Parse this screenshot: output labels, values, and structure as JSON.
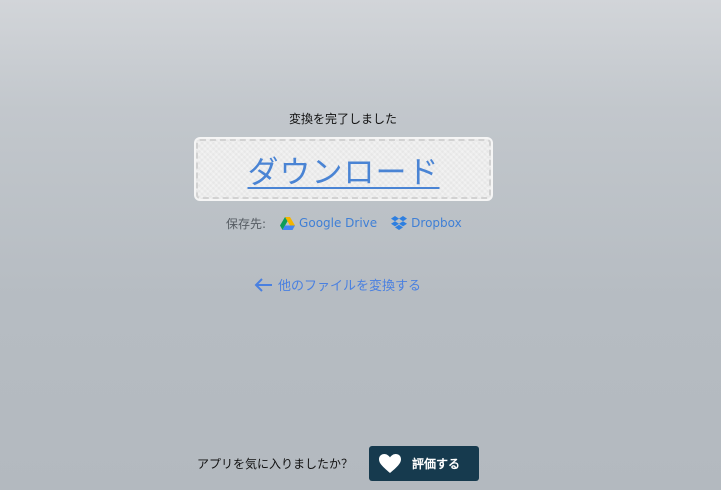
{
  "status": {
    "message": "変換を完了しました"
  },
  "download": {
    "label": "ダウンロード"
  },
  "save": {
    "label": "保存先:",
    "targets": [
      {
        "label": "Google Drive",
        "icon": "google-drive-icon"
      },
      {
        "label": "Dropbox",
        "icon": "dropbox-icon"
      }
    ]
  },
  "convert_other": {
    "label": "他のファイルを変換する",
    "icon": "arrow-left-icon"
  },
  "rating": {
    "question": "アプリを気に入りましたか？",
    "button_label": "評価する",
    "icon": "heart-icon"
  },
  "colors": {
    "link": "#4a84d4",
    "rate_button_bg": "#163a4e"
  }
}
